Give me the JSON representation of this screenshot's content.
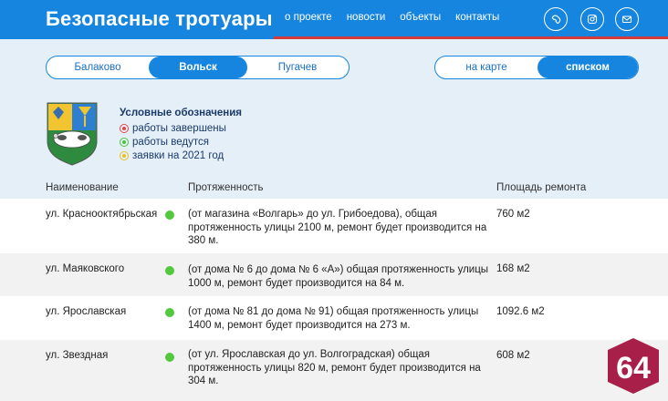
{
  "header": {
    "title": "Безопасные тротуары",
    "nav": [
      "о проекте",
      "новости",
      "объекты",
      "контакты"
    ],
    "social_icons": [
      "phone-icon",
      "instagram-icon",
      "mail-icon"
    ],
    "colors": {
      "header_bg": "#1685e0",
      "accent_red": "#d33b3b"
    }
  },
  "cities": {
    "options": [
      "Балаково",
      "Вольск",
      "Пугачев"
    ],
    "selected": "Вольск"
  },
  "view_mode": {
    "options": [
      "на карте",
      "списком"
    ],
    "selected": "списком"
  },
  "legend": {
    "title": "Условные обозначения",
    "items": [
      {
        "label": "работы завершены",
        "color": "#e04848"
      },
      {
        "label": "работы ведутся",
        "color": "#4cc23a"
      },
      {
        "label": "заявки на 2021 год",
        "color": "#e8c020"
      }
    ]
  },
  "table": {
    "headers": [
      "Наименование",
      "Протяженность",
      "Площадь ремонта"
    ],
    "rows": [
      {
        "name": "ул. Краснооктябрьская",
        "length": "(от магазина «Волгарь» до ул. Грибоедова), общая протяженность улицы 2100 м, ремонт будет производится на 380 м.",
        "area": "760 м2",
        "status": "работы ведутся"
      },
      {
        "name": "ул. Маяковского",
        "length": "(от дома № 6 до дома № 6 «А») общая протяженность улицы 1000 м, ремонт будет производится на 84 м.",
        "area": "168 м2",
        "status": "работы ведутся"
      },
      {
        "name": "ул. Ярославская",
        "length": "(от дома № 81 до дома № 91) общая протяженность улицы 1400 м, ремонт будет производится на 273 м.",
        "area": "1092.6 м2",
        "status": "работы ведутся"
      },
      {
        "name": "ул. Звездная",
        "length": "(от ул. Ярославская до ул. Волгоградская) общая протяженность улицы 820 м, ремонт будет производится на 304 м.",
        "area": "608 м2",
        "status": "работы ведутся"
      }
    ]
  },
  "badge": {
    "text": "64",
    "color": "#a8204a"
  }
}
